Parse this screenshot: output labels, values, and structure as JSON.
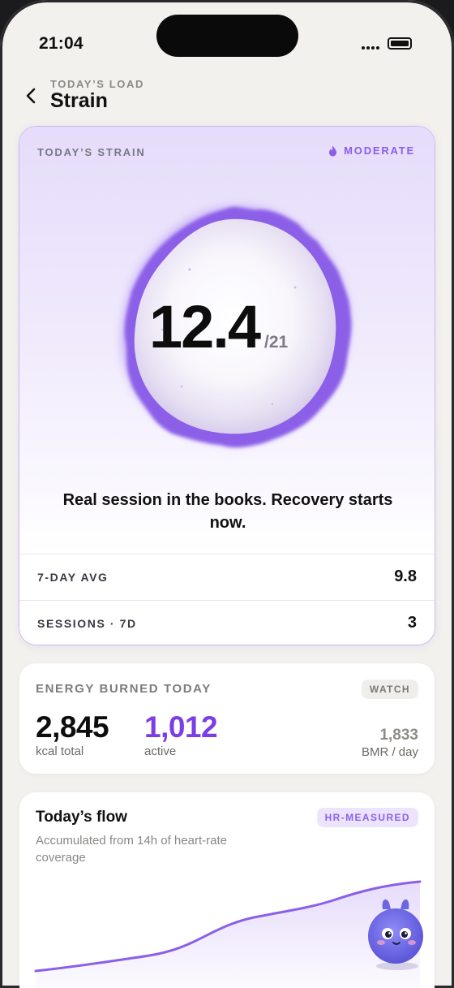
{
  "status": {
    "time": "21:04"
  },
  "header": {
    "kicker": "TODAY’S LOAD",
    "title": "Strain",
    "back_icon": "chevron-left-icon"
  },
  "strain": {
    "label": "TODAY’S STRAIN",
    "level": "MODERATE",
    "level_icon": "flame-icon",
    "score": "12.4",
    "max": "/21",
    "tagline": "Real session in the books. Recovery starts now.",
    "stats": [
      {
        "label": "7-DAY AVG",
        "value": "9.8"
      },
      {
        "label": "SESSIONS · 7D",
        "value": "3"
      }
    ]
  },
  "energy": {
    "title": "ENERGY BURNED TODAY",
    "badge": "WATCH",
    "total": "2,845",
    "total_label": "kcal total",
    "active": "1,012",
    "active_label": "active",
    "bmr": "1,833",
    "bmr_label": "BMR / day"
  },
  "flow": {
    "title": "Today’s flow",
    "badge": "HR-MEASURED",
    "subtitle": "Accumulated from 14h of heart-rate coverage"
  },
  "colors": {
    "accent": "#8a5ee8",
    "active": "#7a3ee6",
    "background": "#f2f1ed"
  }
}
